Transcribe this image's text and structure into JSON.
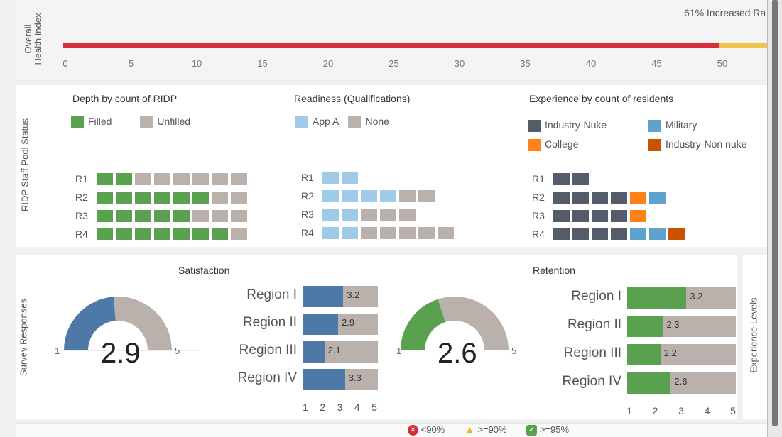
{
  "colors": {
    "green": "#59a14f",
    "gray": "#bab0ac",
    "lightblue": "#a0cbe8",
    "steel": "#4e79a7",
    "dark": "#555c69",
    "military": "#5fa2ce",
    "college": "#ff8218",
    "nonnuke": "#c85200",
    "red": "#d62c3c",
    "yellow": "#f0c34d"
  },
  "health": {
    "axis_label_line1": "Overall",
    "axis_label_line2": "Health Index",
    "top_text": "61% Increased Ra",
    "ticks": [
      "0",
      "5",
      "10",
      "15",
      "20",
      "25",
      "30",
      "35",
      "40",
      "45",
      "50"
    ],
    "red_end_value": 50
  },
  "staff": {
    "axis_label": "RIDP Staff Pool Status",
    "depth": {
      "title": "Depth by count of RIDP",
      "legend": [
        {
          "label": "Filled"
        },
        {
          "label": "Unfilled"
        }
      ],
      "rows": [
        {
          "label": "R1",
          "filled": 2,
          "unfilled": 6
        },
        {
          "label": "R2",
          "filled": 6,
          "unfilled": 2
        },
        {
          "label": "R3",
          "filled": 5,
          "unfilled": 3
        },
        {
          "label": "R4",
          "filled": 7,
          "unfilled": 1
        }
      ]
    },
    "readiness": {
      "title": "Readiness (Qualifications)",
      "legend": [
        {
          "label": "App A"
        },
        {
          "label": "None"
        }
      ],
      "rows": [
        {
          "label": "R1",
          "appa": 2,
          "none": 0
        },
        {
          "label": "R2",
          "appa": 4,
          "none": 2
        },
        {
          "label": "R3",
          "appa": 2,
          "none": 3
        },
        {
          "label": "R4",
          "appa": 2,
          "none": 5
        }
      ]
    },
    "experience": {
      "title": "Experience by count of residents",
      "legend": [
        {
          "label": "Industry-Nuke"
        },
        {
          "label": "Military"
        },
        {
          "label": "College"
        },
        {
          "label": "Industry-Non nuke"
        }
      ],
      "rows": [
        {
          "label": "R1",
          "nuke": 2,
          "college": 0,
          "military": 0,
          "nonnuke": 0
        },
        {
          "label": "R2",
          "nuke": 4,
          "college": 1,
          "military": 1,
          "nonnuke": 0
        },
        {
          "label": "R3",
          "nuke": 4,
          "college": 1,
          "military": 0,
          "nonnuke": 0
        },
        {
          "label": "R4",
          "nuke": 4,
          "college": 0,
          "military": 2,
          "nonnuke": 1
        }
      ]
    }
  },
  "survey": {
    "axis_label": "Survey Responses",
    "satisfaction": {
      "title": "Satisfaction",
      "gauge_value": "2.9",
      "gauge_min": "1",
      "gauge_max": "5",
      "gauge_fraction": 0.475,
      "regions": [
        {
          "label": "Region I",
          "value": "3.2"
        },
        {
          "label": "Region II",
          "value": "2.9"
        },
        {
          "label": "Region III",
          "value": "2.1"
        },
        {
          "label": "Region IV",
          "value": "3.3"
        }
      ],
      "axis_ticks": [
        "1",
        "2",
        "3",
        "4",
        "5"
      ]
    },
    "retention": {
      "title": "Retention",
      "gauge_value": "2.6",
      "gauge_min": "1",
      "gauge_max": "5",
      "gauge_fraction": 0.4,
      "regions": [
        {
          "label": "Region I",
          "value": "3.2"
        },
        {
          "label": "Region II",
          "value": "2.3"
        },
        {
          "label": "Region III",
          "value": "2.2"
        },
        {
          "label": "Region IV",
          "value": "2.6"
        }
      ],
      "axis_ticks": [
        "1",
        "2",
        "3",
        "4",
        "5"
      ]
    }
  },
  "experience_levels_label": "Experience Levels",
  "footer_legend": [
    {
      "icon": "red-x-icon",
      "label": "<90%"
    },
    {
      "icon": "warning-icon",
      "label": ">=90%"
    },
    {
      "icon": "check-icon",
      "label": ">=95%"
    }
  ]
}
